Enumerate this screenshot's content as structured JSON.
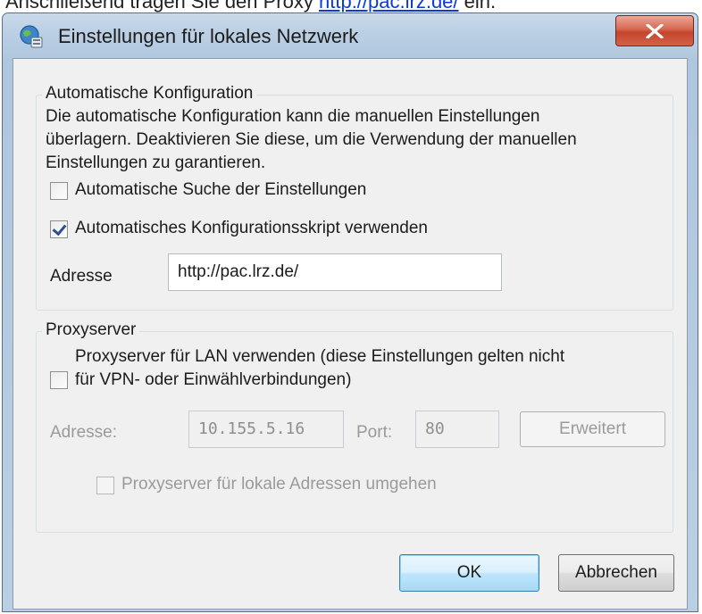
{
  "document": {
    "text_prefix": "Anschließend tragen Sie den Proxy",
    "link": "http://pac.lrz.de/",
    "text_suffix": "ein."
  },
  "dialog": {
    "title": "Einstellungen für lokales Netzwerk",
    "close_label": "X",
    "auto_config": {
      "legend": "Automatische Konfiguration",
      "description": [
        "Die automatische Konfiguration kann die manuellen Einstellungen",
        "überlagern. Deaktivieren Sie diese, um die Verwendung der manuellen",
        "Einstellungen zu garantieren."
      ],
      "auto_detect": {
        "label": "Automatische Suche der Einstellungen",
        "checked": false
      },
      "use_script": {
        "label": "Automatisches Konfigurationsskript verwenden",
        "checked": true
      },
      "address_label": "Adresse",
      "address_value": "http://pac.lrz.de/"
    },
    "proxy": {
      "legend": "Proxyserver",
      "use_proxy": {
        "label_line1": "Proxyserver für LAN verwenden (diese Einstellungen gelten nicht",
        "label_line2": "für VPN- oder Einwählverbindungen)",
        "checked": false
      },
      "address_label": "Adresse:",
      "address_value": "10.155.5.16",
      "port_label": "Port:",
      "port_value": "80",
      "advanced_button": "Erweitert",
      "bypass_local": {
        "label": "Proxyserver für lokale Adressen umgehen",
        "checked": false
      }
    },
    "buttons": {
      "ok": "OK",
      "cancel": "Abbrechen"
    }
  },
  "colors": {
    "link": "#0b3bd6",
    "titlebar": "#bcd0e4",
    "close_button": "#c4452c",
    "default_button": "#bee6fd",
    "client_bg": "#f0f0f0"
  },
  "icons": {
    "title_icon": "network-globe-icon",
    "close_icon": "close-x-icon"
  }
}
